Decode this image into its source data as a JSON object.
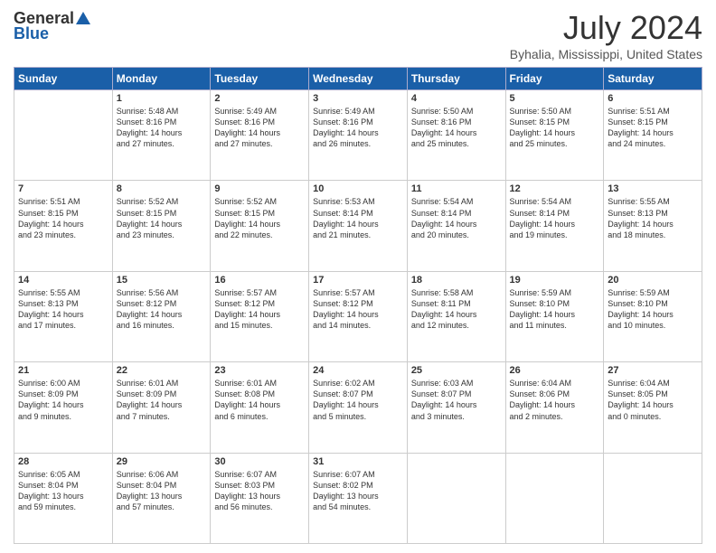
{
  "header": {
    "logo_general": "General",
    "logo_blue": "Blue",
    "title": "July 2024",
    "location": "Byhalia, Mississippi, United States"
  },
  "days_of_week": [
    "Sunday",
    "Monday",
    "Tuesday",
    "Wednesday",
    "Thursday",
    "Friday",
    "Saturday"
  ],
  "weeks": [
    [
      {
        "day": "",
        "text": ""
      },
      {
        "day": "1",
        "text": "Sunrise: 5:48 AM\nSunset: 8:16 PM\nDaylight: 14 hours\nand 27 minutes."
      },
      {
        "day": "2",
        "text": "Sunrise: 5:49 AM\nSunset: 8:16 PM\nDaylight: 14 hours\nand 27 minutes."
      },
      {
        "day": "3",
        "text": "Sunrise: 5:49 AM\nSunset: 8:16 PM\nDaylight: 14 hours\nand 26 minutes."
      },
      {
        "day": "4",
        "text": "Sunrise: 5:50 AM\nSunset: 8:16 PM\nDaylight: 14 hours\nand 25 minutes."
      },
      {
        "day": "5",
        "text": "Sunrise: 5:50 AM\nSunset: 8:15 PM\nDaylight: 14 hours\nand 25 minutes."
      },
      {
        "day": "6",
        "text": "Sunrise: 5:51 AM\nSunset: 8:15 PM\nDaylight: 14 hours\nand 24 minutes."
      }
    ],
    [
      {
        "day": "7",
        "text": "Sunrise: 5:51 AM\nSunset: 8:15 PM\nDaylight: 14 hours\nand 23 minutes."
      },
      {
        "day": "8",
        "text": "Sunrise: 5:52 AM\nSunset: 8:15 PM\nDaylight: 14 hours\nand 23 minutes."
      },
      {
        "day": "9",
        "text": "Sunrise: 5:52 AM\nSunset: 8:15 PM\nDaylight: 14 hours\nand 22 minutes."
      },
      {
        "day": "10",
        "text": "Sunrise: 5:53 AM\nSunset: 8:14 PM\nDaylight: 14 hours\nand 21 minutes."
      },
      {
        "day": "11",
        "text": "Sunrise: 5:54 AM\nSunset: 8:14 PM\nDaylight: 14 hours\nand 20 minutes."
      },
      {
        "day": "12",
        "text": "Sunrise: 5:54 AM\nSunset: 8:14 PM\nDaylight: 14 hours\nand 19 minutes."
      },
      {
        "day": "13",
        "text": "Sunrise: 5:55 AM\nSunset: 8:13 PM\nDaylight: 14 hours\nand 18 minutes."
      }
    ],
    [
      {
        "day": "14",
        "text": "Sunrise: 5:55 AM\nSunset: 8:13 PM\nDaylight: 14 hours\nand 17 minutes."
      },
      {
        "day": "15",
        "text": "Sunrise: 5:56 AM\nSunset: 8:12 PM\nDaylight: 14 hours\nand 16 minutes."
      },
      {
        "day": "16",
        "text": "Sunrise: 5:57 AM\nSunset: 8:12 PM\nDaylight: 14 hours\nand 15 minutes."
      },
      {
        "day": "17",
        "text": "Sunrise: 5:57 AM\nSunset: 8:12 PM\nDaylight: 14 hours\nand 14 minutes."
      },
      {
        "day": "18",
        "text": "Sunrise: 5:58 AM\nSunset: 8:11 PM\nDaylight: 14 hours\nand 12 minutes."
      },
      {
        "day": "19",
        "text": "Sunrise: 5:59 AM\nSunset: 8:10 PM\nDaylight: 14 hours\nand 11 minutes."
      },
      {
        "day": "20",
        "text": "Sunrise: 5:59 AM\nSunset: 8:10 PM\nDaylight: 14 hours\nand 10 minutes."
      }
    ],
    [
      {
        "day": "21",
        "text": "Sunrise: 6:00 AM\nSunset: 8:09 PM\nDaylight: 14 hours\nand 9 minutes."
      },
      {
        "day": "22",
        "text": "Sunrise: 6:01 AM\nSunset: 8:09 PM\nDaylight: 14 hours\nand 7 minutes."
      },
      {
        "day": "23",
        "text": "Sunrise: 6:01 AM\nSunset: 8:08 PM\nDaylight: 14 hours\nand 6 minutes."
      },
      {
        "day": "24",
        "text": "Sunrise: 6:02 AM\nSunset: 8:07 PM\nDaylight: 14 hours\nand 5 minutes."
      },
      {
        "day": "25",
        "text": "Sunrise: 6:03 AM\nSunset: 8:07 PM\nDaylight: 14 hours\nand 3 minutes."
      },
      {
        "day": "26",
        "text": "Sunrise: 6:04 AM\nSunset: 8:06 PM\nDaylight: 14 hours\nand 2 minutes."
      },
      {
        "day": "27",
        "text": "Sunrise: 6:04 AM\nSunset: 8:05 PM\nDaylight: 14 hours\nand 0 minutes."
      }
    ],
    [
      {
        "day": "28",
        "text": "Sunrise: 6:05 AM\nSunset: 8:04 PM\nDaylight: 13 hours\nand 59 minutes."
      },
      {
        "day": "29",
        "text": "Sunrise: 6:06 AM\nSunset: 8:04 PM\nDaylight: 13 hours\nand 57 minutes."
      },
      {
        "day": "30",
        "text": "Sunrise: 6:07 AM\nSunset: 8:03 PM\nDaylight: 13 hours\nand 56 minutes."
      },
      {
        "day": "31",
        "text": "Sunrise: 6:07 AM\nSunset: 8:02 PM\nDaylight: 13 hours\nand 54 minutes."
      },
      {
        "day": "",
        "text": ""
      },
      {
        "day": "",
        "text": ""
      },
      {
        "day": "",
        "text": ""
      }
    ]
  ]
}
